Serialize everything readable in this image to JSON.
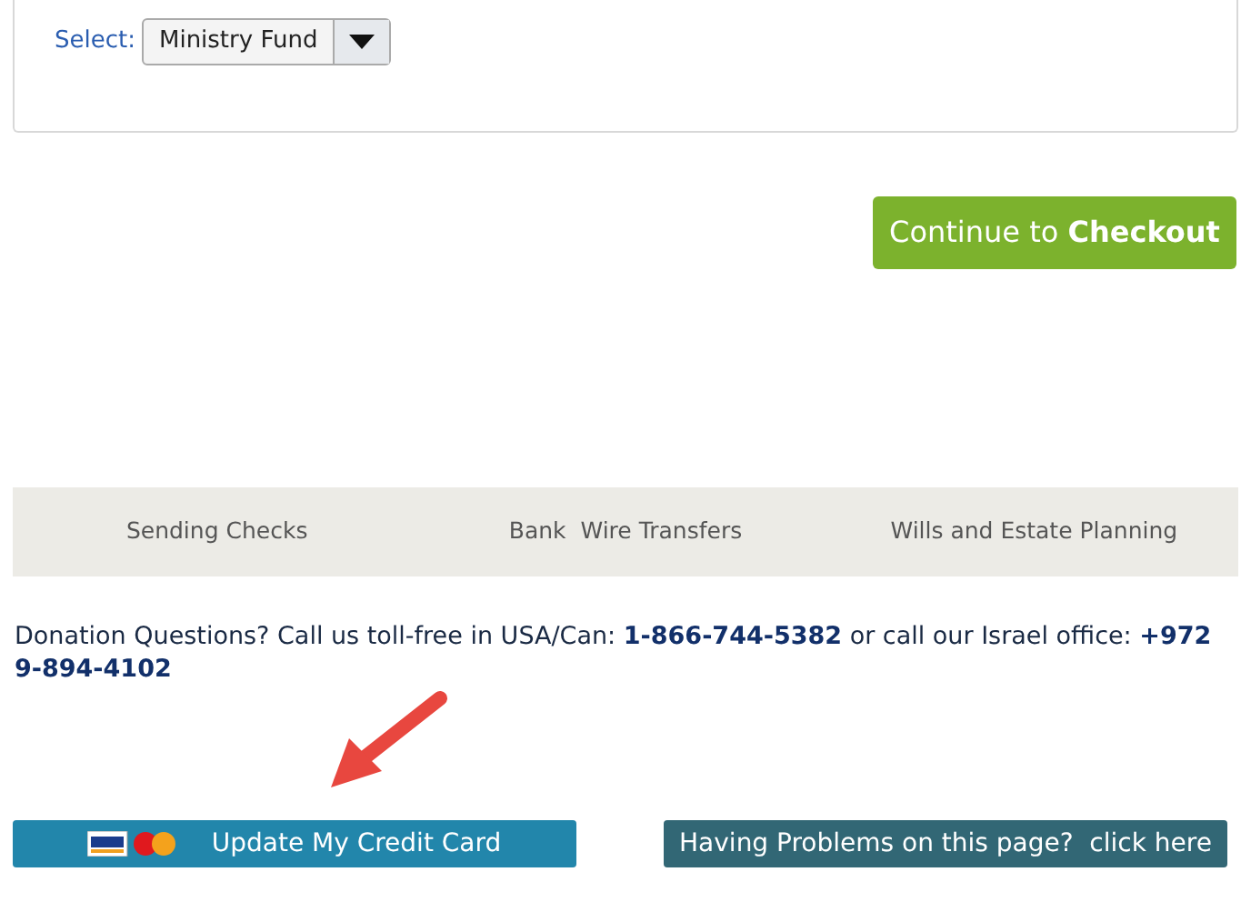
{
  "fund_select": {
    "label": "Select:",
    "value": "Ministry Fund"
  },
  "checkout_button": {
    "text": "Continue to **Checkout**"
  },
  "footer_links": [
    "Sending Checks",
    "Bank  Wire Transfers",
    "Wills and Estate Planning"
  ],
  "contact_text": "Donation Questions? Call us toll-free in USA/Can: **1-866-744-5382** or call our Israel office: **+972 9-894-4102**",
  "buttons": [
    {
      "kind": "card",
      "text": "Update My Credit Card"
    },
    {
      "kind": "help",
      "text": "Having Problems on this page?  click here"
    }
  ]
}
